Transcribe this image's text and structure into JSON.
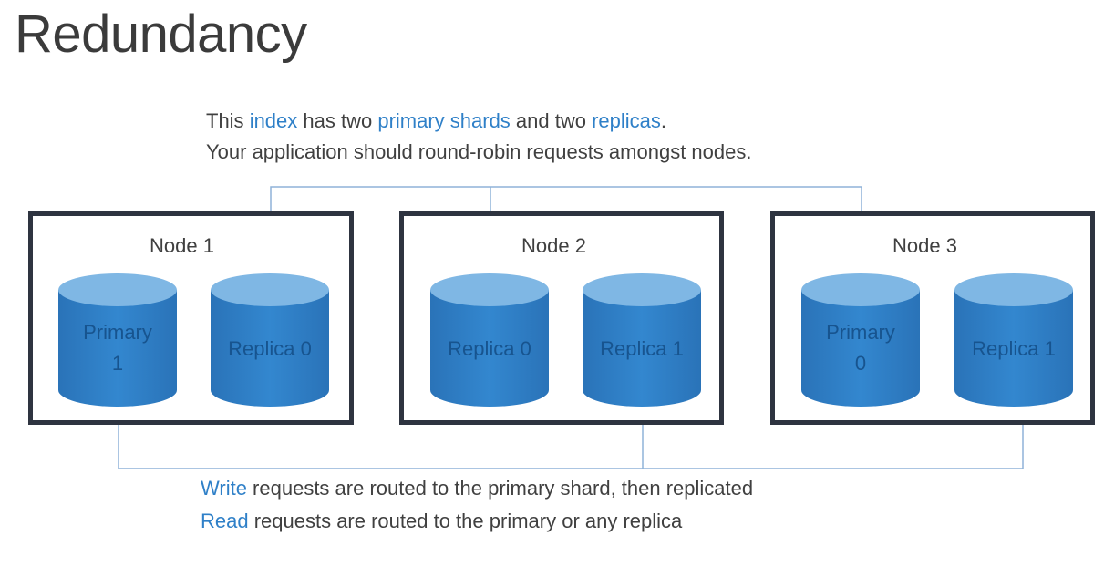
{
  "title": "Redundancy",
  "intro": {
    "line1": {
      "p1": "This ",
      "index": "index",
      "p2": " has two ",
      "primary_shards": "primary shards",
      "p3": " and two ",
      "replicas": "replicas",
      "p4": "."
    },
    "line2": "Your application should round-robin requests amongst nodes."
  },
  "nodes": [
    {
      "label": "Node 1",
      "shards": [
        {
          "line1": "Primary",
          "line2": "1"
        },
        {
          "line1": "Replica 0"
        }
      ]
    },
    {
      "label": "Node 2",
      "shards": [
        {
          "line1": "Replica 0"
        },
        {
          "line1": "Replica 1"
        }
      ]
    },
    {
      "label": "Node 3",
      "shards": [
        {
          "line1": "Primary",
          "line2": "0"
        },
        {
          "line1": "Replica 1"
        }
      ]
    }
  ],
  "footer": {
    "write_word": "Write",
    "write_rest": " requests are routed to the primary shard, then replicated",
    "read_word": "Read",
    "read_rest": " requests are routed to the primary or any replica"
  },
  "colors": {
    "cylinder_body": "#2f7fc6",
    "cylinder_top": "#7fb7e4",
    "cylinder_text": "#17548f",
    "accent_text": "#2f80c8",
    "node_border": "#2e3440",
    "arrow_line": "#8fb2d8"
  }
}
